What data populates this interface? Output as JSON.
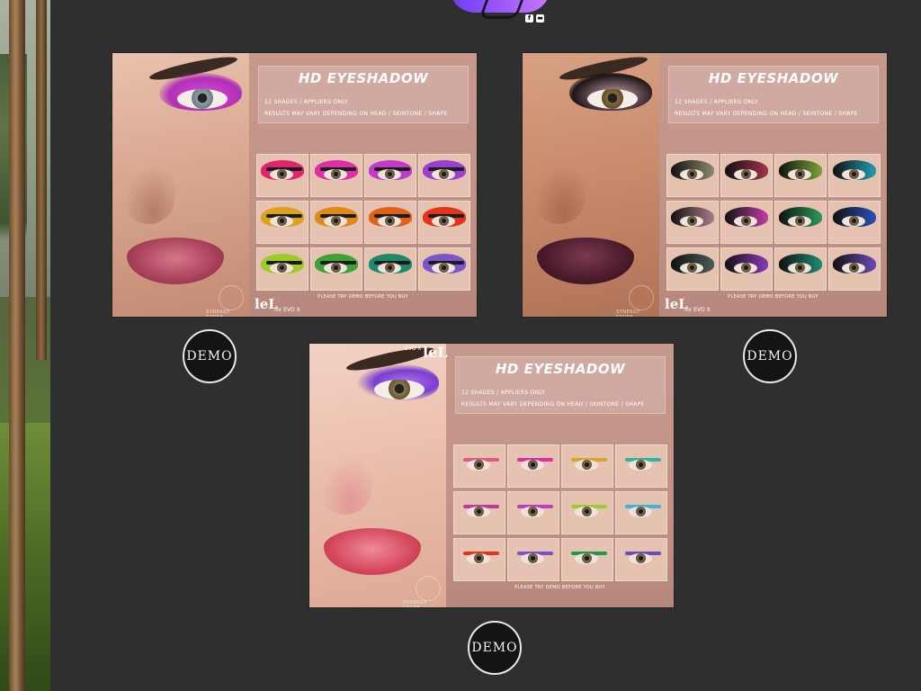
{
  "logo": {
    "social": [
      "f",
      "▬"
    ]
  },
  "panels": [
    {
      "id": "purple",
      "title": "HD EYESHADOW",
      "line1": "12 SHADES / APPLIERS ONLY",
      "line2": "RESULTS MAY VARY DEPENDING ON HEAD / SKINTONE / SHAPE",
      "note": "PLEASE TRY DEMO BEFORE YOU BUY",
      "lel": "leL",
      "evo": "for EVO X",
      "brand_small": "SYNERGY STORE",
      "lid_color": "#d43bd0",
      "lip_color": "#b8475f",
      "swatches": [
        "#e2246b",
        "#df2fa6",
        "#c23ac9",
        "#9b3fd0",
        "#d9a31b",
        "#e08a1a",
        "#e0621a",
        "#e0341d",
        "#9fcb2a",
        "#3da23a",
        "#1f8a6b",
        "#7c56c8"
      ]
    },
    {
      "id": "dark",
      "title": "HD EYESHADOW",
      "line1": "12 SHADES / APPLIERS ONLY",
      "line2": "RESULTS MAY VARY DEPENDING ON HEAD / SKINTONE / SHAPE",
      "note": "PLEASE TRY DEMO BEFORE YOU BUY",
      "lel": "leL",
      "evo": "for EVO X",
      "brand_small": "SYNERGY STORE",
      "lid_color": "#b7808e",
      "lip_color": "#4a1a2b",
      "swatches": [
        "#8c8a6a",
        "#a3344a",
        "#7aa23a",
        "#1f9fb4",
        "#a87c8a",
        "#c23ca8",
        "#2a9a5a",
        "#2a4fb8",
        "#4c5a5a",
        "#8a3ab8",
        "#1f8a72",
        "#6a4ab8"
      ]
    },
    {
      "id": "liner",
      "title": "HD EYESHADOW",
      "line1": "12 SHADES / APPLIERS ONLY",
      "line2": "RESULTS MAY VARY DEPENDING ON HEAD / SKINTONE / SHAPE",
      "note": "PLEASE TRY DEMO BEFORE YOU BUY",
      "lel": "leL",
      "evo": "EVO X",
      "brand_small": "SYNERGY STORE",
      "lid_color": "#9d56e0",
      "lip_color": "#d5475c",
      "swatches": [
        "#e05a86",
        "#df2fa6",
        "#d6a52a",
        "#2ab7a5",
        "#c03a9a",
        "#c23ac9",
        "#9fcb2a",
        "#3fb5d6",
        "#e0341d",
        "#7c4fd0",
        "#1f9a4a",
        "#6a4ab8"
      ]
    }
  ],
  "demo_label": "DEMO"
}
